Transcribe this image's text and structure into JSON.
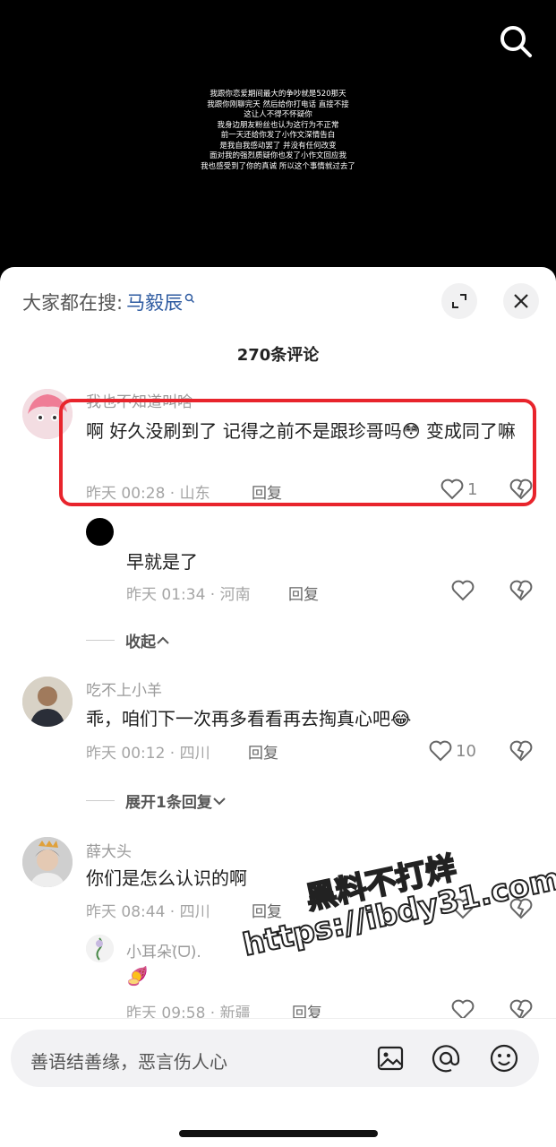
{
  "video": {
    "overlay_lines": [
      "我跟你恋爱期间最大的争吵就是520那天",
      "我跟你刚聊完天 然后给你打电话 直接不接",
      "这让人不得不怀疑你",
      "我身边朋友粉丝也认为这行为不正常",
      "前一天还给你发了小作文深情告白",
      "是我自我感动罢了 并没有任何改变",
      "面对我的强烈质疑你也发了小作文回应我",
      "我也感受到了你的真诚 所以这个事情就过去了"
    ]
  },
  "sheet": {
    "search_prefix": "大家都在搜:",
    "search_keyword": "马毅辰",
    "comment_count": "270条评论"
  },
  "comments": [
    {
      "username": "我也不知道叫啥",
      "text": "啊 好久没刷到了 记得之前不是跟珍哥吗😳 变成同了嘛",
      "time_loc": "昨天 00:28 · 山东",
      "reply_label": "回复",
      "likes": "1"
    },
    {
      "username": "",
      "text": "早就是了",
      "time_loc": "昨天 01:34 · 河南",
      "reply_label": "回复",
      "likes": ""
    },
    {
      "username": "吃不上小羊",
      "text": "乖，咱们下一次再多看看再去掏真心吧😂",
      "time_loc": "昨天 00:12 · 四川",
      "reply_label": "回复",
      "likes": "10"
    },
    {
      "username": "薛大头",
      "text": "你们是怎么认识的啊",
      "time_loc": "昨天 08:44 · 四川",
      "reply_label": "回复",
      "likes": ""
    },
    {
      "username": "小耳朵(̀ᗜ).",
      "text": "🍠",
      "time_loc": "昨天 09:58 · 新疆",
      "reply_label": "回复",
      "likes": ""
    }
  ],
  "toggles": {
    "collapse": "收起",
    "expand": "展开1条回复"
  },
  "watermark": {
    "line1": "黑料不打烊",
    "line2": "https://ibdy31.com"
  },
  "input": {
    "placeholder": "善语结善缘，恶言伤人心"
  },
  "icons": {
    "search": "search-icon",
    "expand": "expand-icon",
    "close": "close-icon",
    "like": "heart-icon",
    "dislike": "broken-heart-icon",
    "image": "image-icon",
    "mention": "at-icon",
    "emoji": "emoji-icon"
  }
}
